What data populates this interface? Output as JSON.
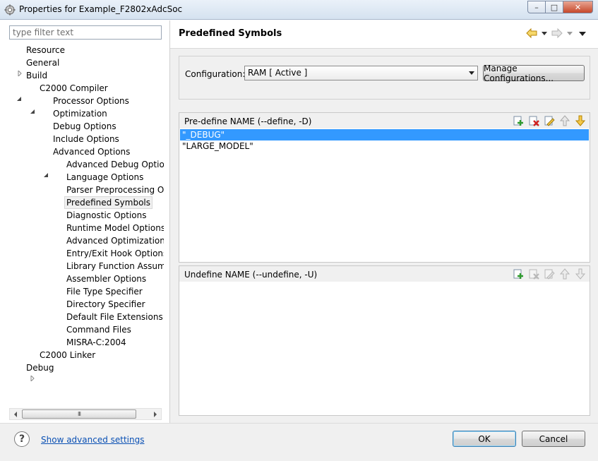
{
  "window": {
    "title": "Properties for Example_F2802xAdcSoc",
    "min_glyph": "–",
    "max_glyph": "□",
    "close_glyph": "✕"
  },
  "filter": {
    "placeholder": "type filter text"
  },
  "tree": {
    "nodes": [
      {
        "label": "Resource"
      },
      {
        "label": "General"
      },
      {
        "label": "Build"
      },
      {
        "label": "C2000 Compiler"
      },
      {
        "label": "Processor Options"
      },
      {
        "label": "Optimization"
      },
      {
        "label": "Debug Options"
      },
      {
        "label": "Include Options"
      },
      {
        "label": "Advanced Options"
      },
      {
        "label": "Advanced Debug Options"
      },
      {
        "label": "Language Options"
      },
      {
        "label": "Parser Preprocessing Opti"
      },
      {
        "label": "Predefined Symbols"
      },
      {
        "label": "Diagnostic Options"
      },
      {
        "label": "Runtime Model Options"
      },
      {
        "label": "Advanced Optimizations"
      },
      {
        "label": "Entry/Exit Hook Options"
      },
      {
        "label": "Library Function Assumpt"
      },
      {
        "label": "Assembler Options"
      },
      {
        "label": "File Type Specifier"
      },
      {
        "label": "Directory Specifier"
      },
      {
        "label": "Default File Extensions"
      },
      {
        "label": "Command Files"
      },
      {
        "label": "MISRA-C:2004"
      },
      {
        "label": "C2000 Linker"
      },
      {
        "label": "Debug"
      }
    ],
    "scroll_grip": "III"
  },
  "page": {
    "title": "Predefined Symbols"
  },
  "config": {
    "label": "Configuration:",
    "selected": "RAM  [ Active ]",
    "manage_label": "Manage Configurations..."
  },
  "define": {
    "title": "Pre-define NAME (--define, -D)",
    "items": [
      "\"_DEBUG\"",
      "\"LARGE_MODEL\""
    ]
  },
  "undefine": {
    "title": "Undefine NAME (--undefine, -U)",
    "items": []
  },
  "footer": {
    "help_glyph": "?",
    "advanced_link": "Show advanced settings",
    "ok_label": "OK",
    "cancel_label": "Cancel"
  }
}
